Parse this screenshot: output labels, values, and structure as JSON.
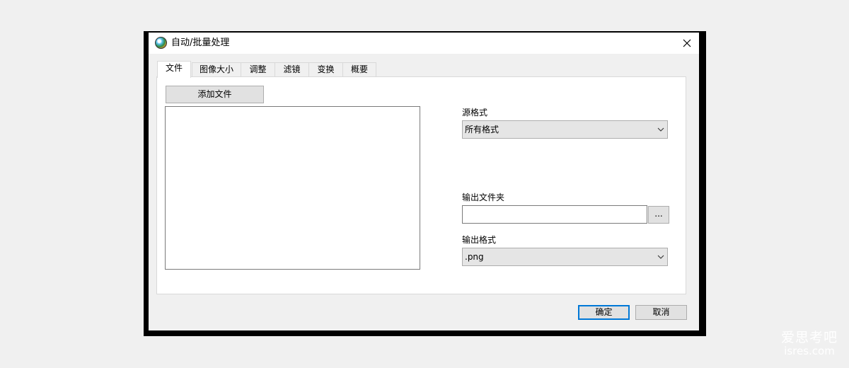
{
  "window": {
    "title": "自动/批量处理",
    "close_glyph": "✕"
  },
  "tabs": [
    {
      "label": "文件",
      "active": true
    },
    {
      "label": "图像大小",
      "active": false
    },
    {
      "label": "调整",
      "active": false
    },
    {
      "label": "滤镜",
      "active": false
    },
    {
      "label": "变换",
      "active": false
    },
    {
      "label": "概要",
      "active": false
    }
  ],
  "files": {
    "add_button_label": "添加文件",
    "items": []
  },
  "source_format": {
    "label": "源格式",
    "selected": "所有格式"
  },
  "output_folder": {
    "label": "输出文件夹",
    "value": "",
    "browse_label": "..."
  },
  "output_format": {
    "label": "输出格式",
    "selected": ".png"
  },
  "footer": {
    "ok_label": "确定",
    "cancel_label": "取消"
  },
  "watermark": {
    "line1": "爱思考吧",
    "line2": "isres.com"
  },
  "colors": {
    "accent": "#0078d7",
    "button_bg": "#e1e1e1",
    "frame": "#000000"
  }
}
